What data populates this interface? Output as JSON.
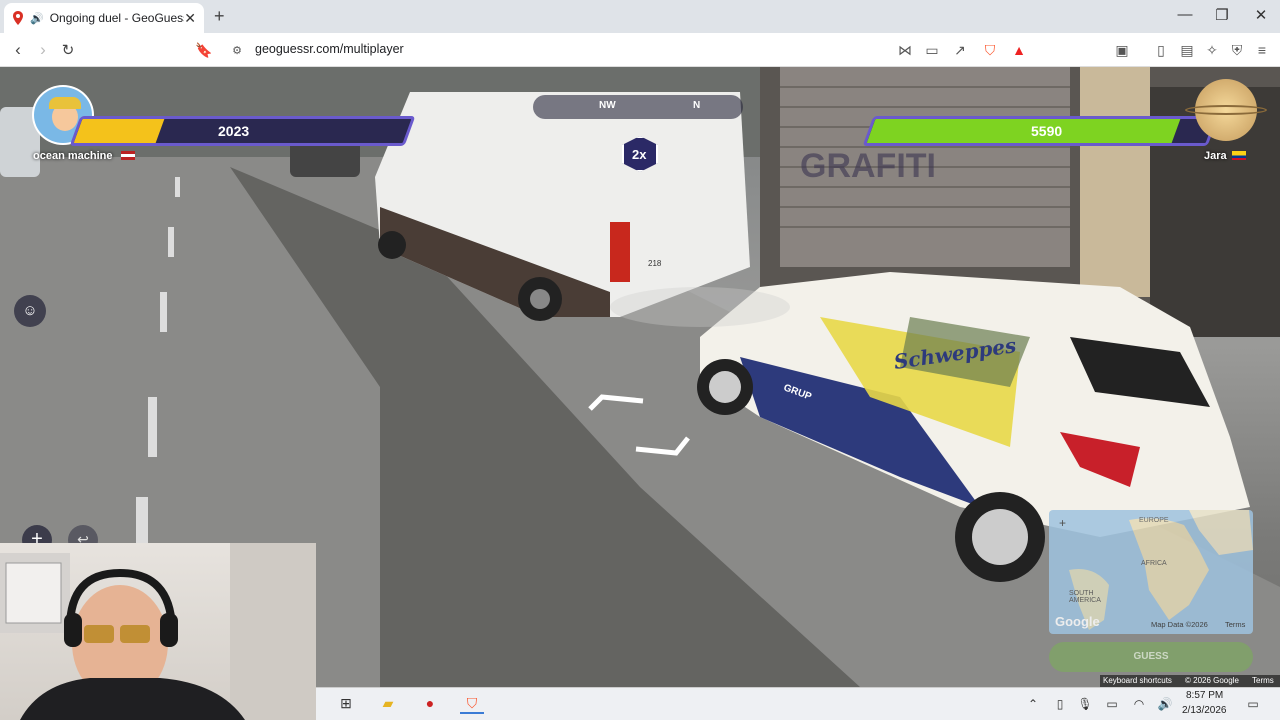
{
  "browser": {
    "tab_title": "Ongoing duel - GeoGuessr",
    "url": "geoguessr.com/multiplayer",
    "new_tab_label": "+",
    "tab_close_label": "✕"
  },
  "game": {
    "player_left": {
      "name": "ocean machine",
      "score": "2023",
      "health": 0.25
    },
    "player_right": {
      "name": "Jara",
      "score": "5590",
      "health": 0.9
    },
    "multiplier": "2x",
    "compass": {
      "nw": "NW",
      "n": "N"
    },
    "guess_label": "GUESS",
    "map_labels": {
      "europe": "EUROPE",
      "africa": "AFRICA",
      "south_america": "SOUTH AMERICA"
    },
    "map_footer": {
      "google": "Google",
      "map_data": "Map Data ©2026",
      "terms": "Terms"
    },
    "scene_footer": {
      "shortcuts": "Keyboard shortcuts",
      "copyright": "© 2026 Google",
      "terms": "Terms"
    },
    "plus_label": "+",
    "van_plate": "218",
    "car_text": "Schweppes",
    "car_logo": "GRUP"
  },
  "taskbar": {
    "time": "8:57 PM",
    "date": "2/13/2026"
  },
  "colors": {
    "left_bar": "#f4c21b",
    "right_bar": "#7ed321",
    "bar_bg": "#2a2850",
    "bar_border": "#6a5acd"
  }
}
